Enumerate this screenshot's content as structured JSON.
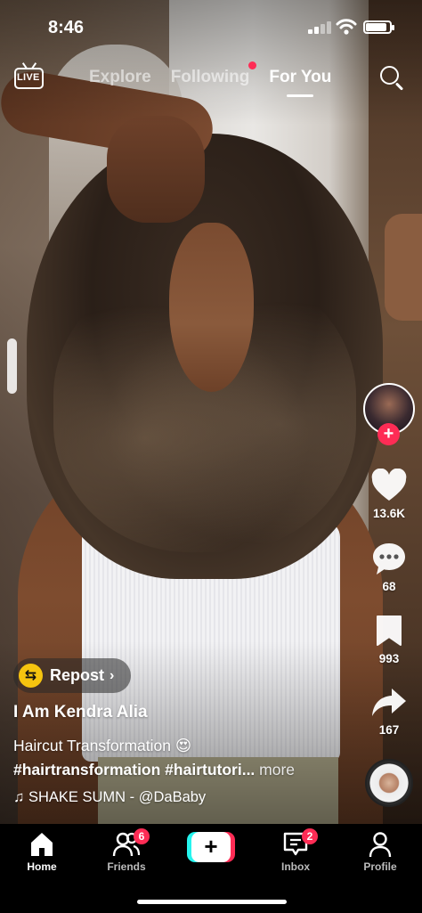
{
  "status_bar": {
    "time": "8:46"
  },
  "top_nav": {
    "live_label": "LIVE",
    "tabs": [
      {
        "label": "Explore",
        "active": false
      },
      {
        "label": "Following",
        "active": false,
        "has_dot": true
      },
      {
        "label": "For You",
        "active": true
      }
    ]
  },
  "rail": {
    "likes": "13.6K",
    "comments": "68",
    "saves": "993",
    "shares": "167",
    "follow_symbol": "+"
  },
  "post": {
    "repost_label": "Repost",
    "repost_chevron": "›",
    "author": "I Am Kendra Alia",
    "caption": "Haircut Transformation 😍",
    "hashtags": "#hairtransformation #hairtutori...",
    "more_label": "more",
    "music": "♫ SHAKE SUMN - @DaBaby"
  },
  "bottom_nav": {
    "items": [
      {
        "label": "Home",
        "active": true
      },
      {
        "label": "Friends",
        "badge": "6"
      },
      {
        "label": "Create",
        "symbol": "+"
      },
      {
        "label": "Inbox",
        "badge": "2"
      },
      {
        "label": "Profile"
      }
    ]
  },
  "colors": {
    "accent": "#fe2c55",
    "cyan": "#25f4ee",
    "repost": "#f6c40f"
  }
}
